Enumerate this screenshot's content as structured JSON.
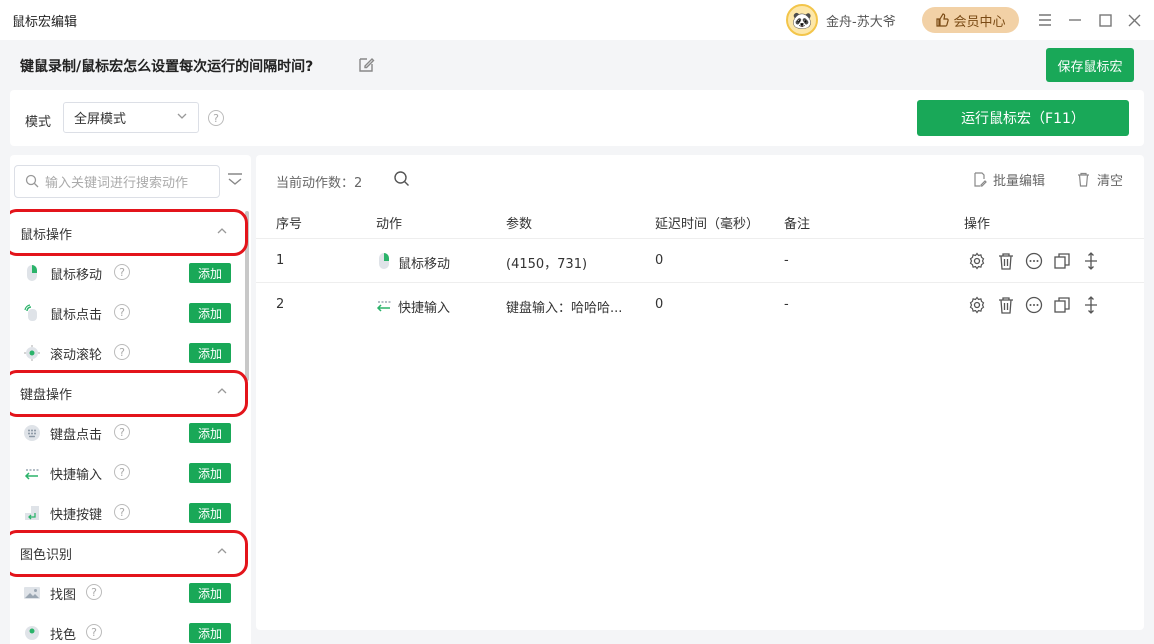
{
  "app": {
    "title": "鼠标宏编辑",
    "username": "金舟-苏大爷",
    "vip_label": "会员中心"
  },
  "macro": {
    "name": "键鼠录制/鼠标宏怎么设置每次运行的间隔时间?",
    "save_label": "保存鼠标宏"
  },
  "mode": {
    "label": "模式",
    "value": "全屏模式",
    "run_label": "运行鼠标宏（F11）"
  },
  "sidebar": {
    "search_placeholder": "输入关键词进行搜索动作",
    "add_label": "添加",
    "categories": [
      {
        "title": "鼠标操作",
        "items": [
          {
            "label": "鼠标移动",
            "icon": "mouse-move-icon"
          },
          {
            "label": "鼠标点击",
            "icon": "mouse-click-icon"
          },
          {
            "label": "滚动滚轮",
            "icon": "scroll-wheel-icon"
          }
        ]
      },
      {
        "title": "键盘操作",
        "items": [
          {
            "label": "键盘点击",
            "icon": "keyboard-icon"
          },
          {
            "label": "快捷输入",
            "icon": "quick-input-icon"
          },
          {
            "label": "快捷按键",
            "icon": "hotkey-icon"
          }
        ]
      },
      {
        "title": "图色识别",
        "items": [
          {
            "label": "找图",
            "icon": "image-icon"
          },
          {
            "label": "找色",
            "icon": "color-icon"
          }
        ]
      }
    ]
  },
  "actions": {
    "count_label": "当前动作数：2",
    "batch_edit_label": "批量编辑",
    "clear_label": "清空",
    "columns": [
      "序号",
      "动作",
      "参数",
      "延迟时间（毫秒）",
      "备注",
      "操作"
    ],
    "rows": [
      {
        "index": "1",
        "action": "鼠标移动",
        "params": "(4150，731)",
        "delay": "0",
        "note": "-"
      },
      {
        "index": "2",
        "action": "快捷输入",
        "params": "键盘输入：哈哈哈...",
        "delay": "0",
        "note": "-"
      }
    ]
  },
  "colors": {
    "primary": "#19a858",
    "highlight_ring": "#e3141b",
    "vip_bg": "#f2d1a6"
  }
}
